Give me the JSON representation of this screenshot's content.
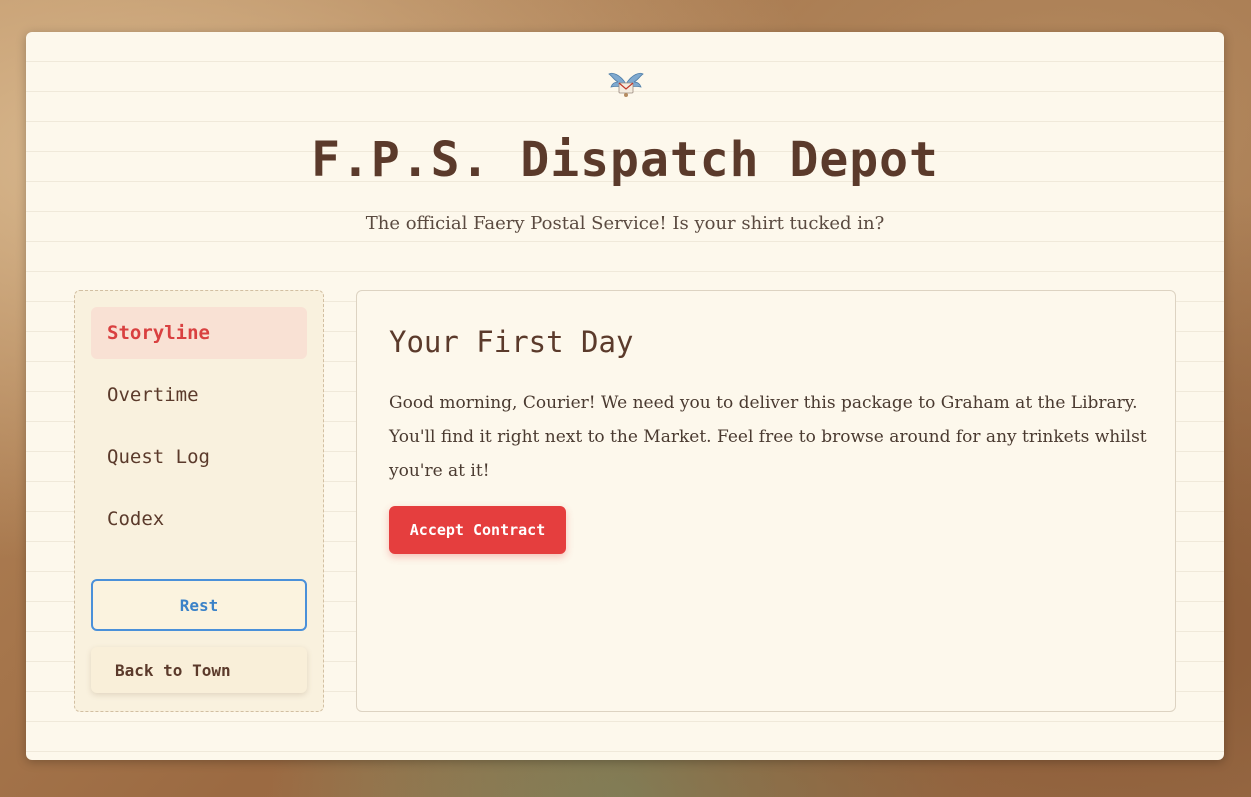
{
  "header": {
    "logo_icon": "winged-envelope-icon",
    "title": "F.P.S. Dispatch Depot",
    "subtitle": "The official Faery Postal Service! Is your shirt tucked in?"
  },
  "sidebar": {
    "items": [
      {
        "label": "Storyline",
        "active": true
      },
      {
        "label": "Overtime",
        "active": false
      },
      {
        "label": "Quest Log",
        "active": false
      },
      {
        "label": "Codex",
        "active": false
      }
    ],
    "rest_label": "Rest",
    "back_label": "Back to Town"
  },
  "content": {
    "title": "Your First Day",
    "body": "Good morning, Courier! We need you to deliver this package to Graham at the Library. You'll find it right next to the Market. Feel free to browse around for any trinkets whilst you're at it!",
    "button_label": "Accept Contract"
  },
  "colors": {
    "accent_red": "#e53e3e",
    "rest_blue": "#4a90d9",
    "text_brown": "#5b3a2b",
    "active_bg": "#f9e1d4"
  }
}
